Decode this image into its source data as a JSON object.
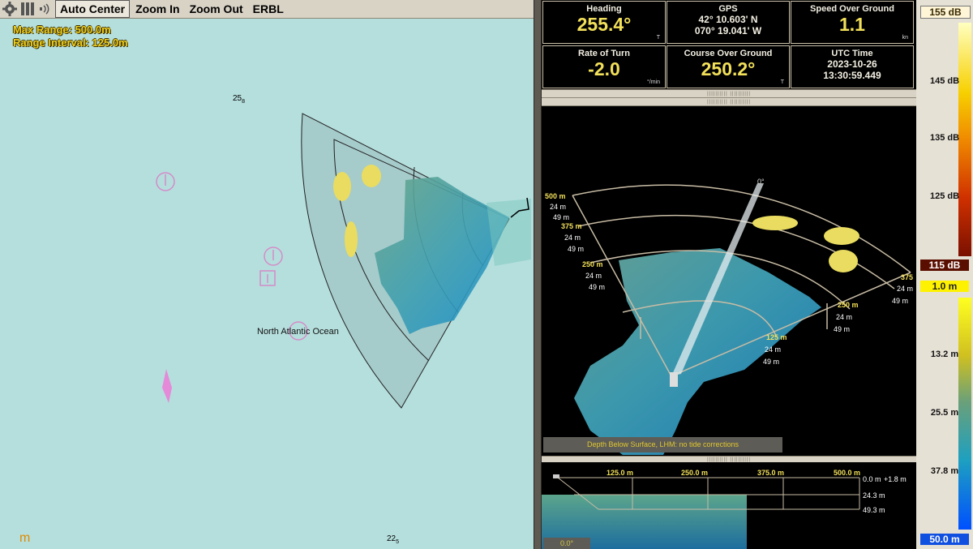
{
  "toolbar": {
    "buttons": {
      "auto_center": "Auto Center",
      "zoom_in": "Zoom In",
      "zoom_out": "Zoom Out",
      "erbl": "ERBL"
    }
  },
  "chart": {
    "max_range": "Max Range: 500.0m",
    "range_interval": "Range Interval: 125.0m",
    "ocean_label": "North Atlantic Ocean",
    "depth_top": {
      "main": "25",
      "sub": "8"
    },
    "depth_bottom": {
      "main": "22",
      "sub": "5"
    },
    "logo": "m"
  },
  "instruments": {
    "heading": {
      "label": "Heading",
      "value": "255.4°",
      "unit": "T"
    },
    "gps": {
      "label": "GPS",
      "lat": "42° 10.603' N",
      "lon": "070° 19.041' W"
    },
    "sog": {
      "label": "Speed Over Ground",
      "value": "1.1",
      "unit": "kn"
    },
    "rot": {
      "label": "Rate of Turn",
      "value": "-2.0",
      "unit": "°/min"
    },
    "cog": {
      "label": "Course Over Ground",
      "value": "250.2°",
      "unit": "T"
    },
    "utc": {
      "label": "UTC Time",
      "date": "2023-10-26",
      "time": "13:30:59.449"
    }
  },
  "view3d": {
    "heading_marker": "0°",
    "ranges": {
      "r500": "500 m",
      "r375": "375 m",
      "r250": "250 m",
      "r125": "125 m"
    },
    "depth24": "24 m",
    "depth49": "49 m",
    "right_375": "375",
    "status": "Depth Below Surface, LHM: no tide corrections"
  },
  "view2d": {
    "x_ticks": [
      "125.0 m",
      "250.0 m",
      "375.0 m",
      "500.0 m"
    ],
    "depths": {
      "d0": "0.0 m",
      "offset": "+1.8 m",
      "d24": "24.3 m",
      "d49": "49.3 m"
    },
    "angle_button": "0.0°"
  },
  "legend": {
    "db_max": "155 dB",
    "db_ticks": [
      "145 dB",
      "135 dB",
      "125 dB"
    ],
    "db_min": "115 dB",
    "depth_min": "1.0 m",
    "depth_ticks": [
      "13.2 m",
      "25.5 m",
      "37.8 m"
    ],
    "depth_max": "50.0 m",
    "colors": {
      "db_top": "#ffffc0",
      "db_bottom": "#7a1000",
      "depth_top": "#ffff20",
      "depth_bottom": "#0050ff"
    }
  }
}
